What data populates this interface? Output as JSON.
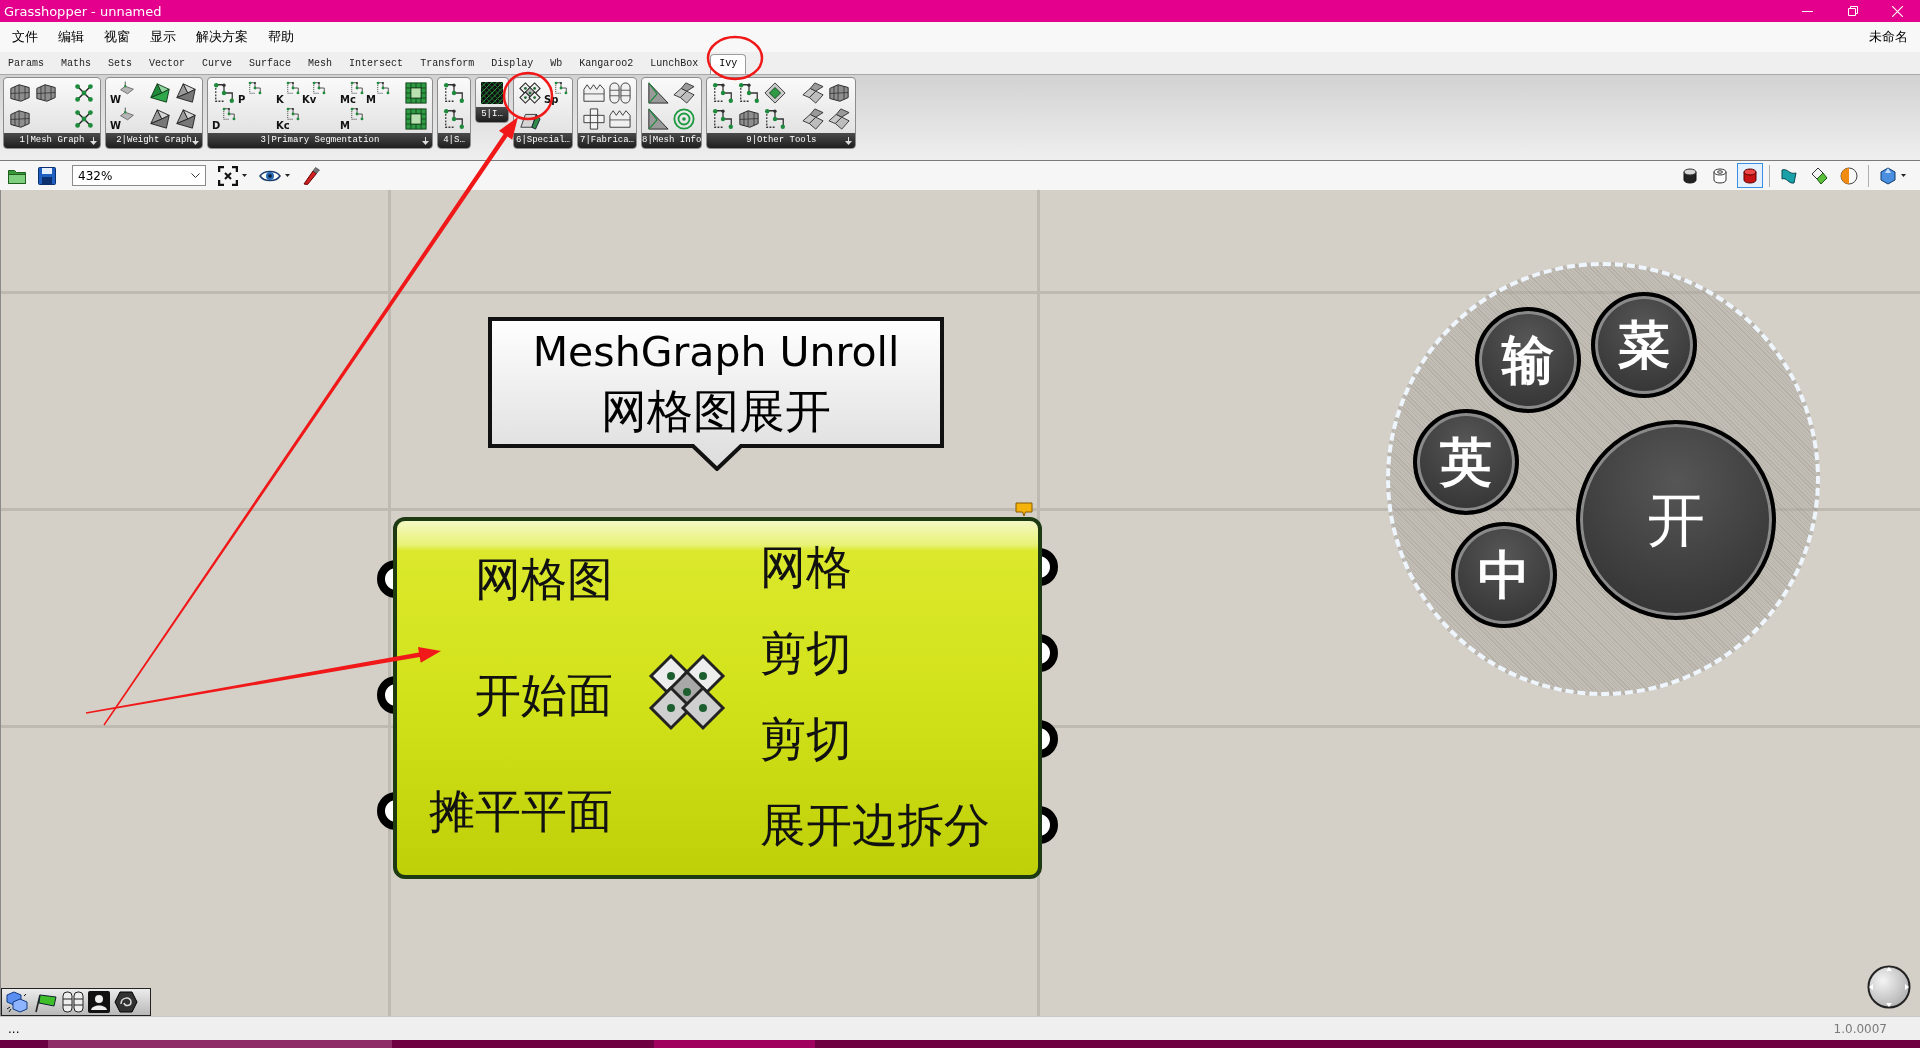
{
  "window": {
    "title": "Grasshopper - unnamed"
  },
  "menu": {
    "items": [
      "文件",
      "编辑",
      "视窗",
      "显示",
      "解决方案",
      "帮助"
    ],
    "document": "未命名"
  },
  "tabs": [
    {
      "label": "Params",
      "selected": false
    },
    {
      "label": "Maths",
      "selected": false
    },
    {
      "label": "Sets",
      "selected": false
    },
    {
      "label": "Vector",
      "selected": false
    },
    {
      "label": "Curve",
      "selected": false
    },
    {
      "label": "Surface",
      "selected": false
    },
    {
      "label": "Mesh",
      "selected": false
    },
    {
      "label": "Intersect",
      "selected": false
    },
    {
      "label": "Transform",
      "selected": false
    },
    {
      "label": "Display",
      "selected": false
    },
    {
      "label": "Wb",
      "selected": false
    },
    {
      "label": "Kangaroo2",
      "selected": false
    },
    {
      "label": "LunchBox",
      "selected": false
    },
    {
      "label": "Ivy",
      "selected": true
    }
  ],
  "ribbon": [
    {
      "label": "1|Mesh Graph",
      "expandable": true,
      "groups": [
        [
          [
            {
              "kind": "mesh"
            },
            {
              "kind": "mesh"
            }
          ],
          [
            {
              "kind": "mesh"
            }
          ]
        ],
        [
          [
            {
              "kind": "graph"
            },
            {
              "kind": "graph"
            }
          ]
        ]
      ]
    },
    {
      "label": "2|Weight Graph",
      "expandable": true,
      "groups": [
        [
          [
            {
              "kind": "weight",
              "letter": "W"
            },
            {
              "kind": "weight",
              "letter": "W"
            }
          ]
        ],
        [
          [
            {
              "kind": "fold-green"
            },
            {
              "kind": "fold"
            }
          ],
          [
            {
              "kind": "fold"
            },
            {
              "kind": "fold"
            }
          ]
        ]
      ]
    },
    {
      "label": "3|Primary Segmentation",
      "expandable": true,
      "groups": [
        [
          [
            {
              "kind": "segment"
            },
            {
              "kind": "segment",
              "letter": "D"
            }
          ],
          [
            {
              "kind": "segment",
              "letter": "P"
            }
          ]
        ],
        [
          [
            {
              "kind": "segment",
              "letter": "K"
            },
            {
              "kind": "segment",
              "letter": "Kc"
            }
          ],
          [
            {
              "kind": "segment",
              "letter": "Kv"
            }
          ]
        ],
        [
          [
            {
              "kind": "segment",
              "letter": "Mc"
            },
            {
              "kind": "segment",
              "letter": "M"
            }
          ],
          [
            {
              "kind": "segment",
              "letter": "M"
            }
          ]
        ],
        [
          [
            {
              "kind": "grid-block"
            },
            {
              "kind": "grid-block"
            }
          ]
        ]
      ]
    },
    {
      "label": "4|S…",
      "expandable": false,
      "groups": [
        [
          [
            {
              "kind": "segment"
            },
            {
              "kind": "segment"
            }
          ]
        ]
      ]
    },
    {
      "label": "5|I…",
      "expandable": false,
      "groups": [
        [
          [
            {
              "kind": "dark-grid"
            }
          ]
        ]
      ]
    },
    {
      "label": "6|Special…",
      "expandable": false,
      "groups": [
        [
          [
            {
              "kind": "unroll"
            },
            {
              "kind": "strip"
            }
          ],
          [
            {
              "kind": "segment",
              "letter": "Sp"
            }
          ]
        ]
      ]
    },
    {
      "label": "7|Fabrica…",
      "expandable": false,
      "groups": [
        [
          [
            {
              "kind": "box"
            },
            {
              "kind": "net"
            }
          ],
          [
            {
              "kind": "capsules"
            },
            {
              "kind": "box"
            }
          ]
        ]
      ]
    },
    {
      "label": "8|Mesh Info",
      "expandable": false,
      "groups": [
        [
          [
            {
              "kind": "triangle"
            },
            {
              "kind": "triangle"
            }
          ],
          [
            {
              "kind": "tiles"
            },
            {
              "kind": "rings"
            }
          ]
        ]
      ]
    },
    {
      "label": "9|Other Tools",
      "expandable": true,
      "groups": [
        [
          [
            {
              "kind": "segment"
            },
            {
              "kind": "segment"
            }
          ],
          [
            {
              "kind": "segment"
            },
            {
              "kind": "mesh"
            }
          ],
          [
            {
              "kind": "diamond"
            },
            {
              "kind": "segment"
            }
          ]
        ],
        [
          [
            {
              "kind": "tiles"
            },
            {
              "kind": "tiles"
            }
          ],
          [
            {
              "kind": "mesh"
            },
            {
              "kind": "tiles"
            }
          ]
        ]
      ]
    }
  ],
  "toolbar": {
    "zoom": "432%",
    "preview_modes": [
      {
        "kind": "hidden",
        "selected": false
      },
      {
        "kind": "wireframe",
        "selected": false
      },
      {
        "kind": "shaded",
        "selected": true
      }
    ]
  },
  "canvas": {
    "callout": {
      "title": "MeshGraph Unroll",
      "subtitle": "网格图展开"
    },
    "component": {
      "inputs": [
        "网格图",
        "开始面",
        "摊平平面"
      ],
      "outputs": [
        "网格",
        "剪切",
        "剪切",
        "展开边拆分"
      ],
      "has_message": true
    },
    "radial_menu": [
      {
        "label": "输",
        "kind": "secondary"
      },
      {
        "label": "菜",
        "kind": "secondary"
      },
      {
        "label": "英",
        "kind": "secondary"
      },
      {
        "label": "开",
        "kind": "primary"
      },
      {
        "label": "中",
        "kind": "secondary"
      }
    ]
  },
  "annotations": [
    {
      "kind": "circle"
    },
    {
      "kind": "circle"
    },
    {
      "kind": "arrow"
    },
    {
      "kind": "arrow"
    }
  ],
  "status_bar": {
    "left": "...",
    "version": "1.0.0007"
  }
}
